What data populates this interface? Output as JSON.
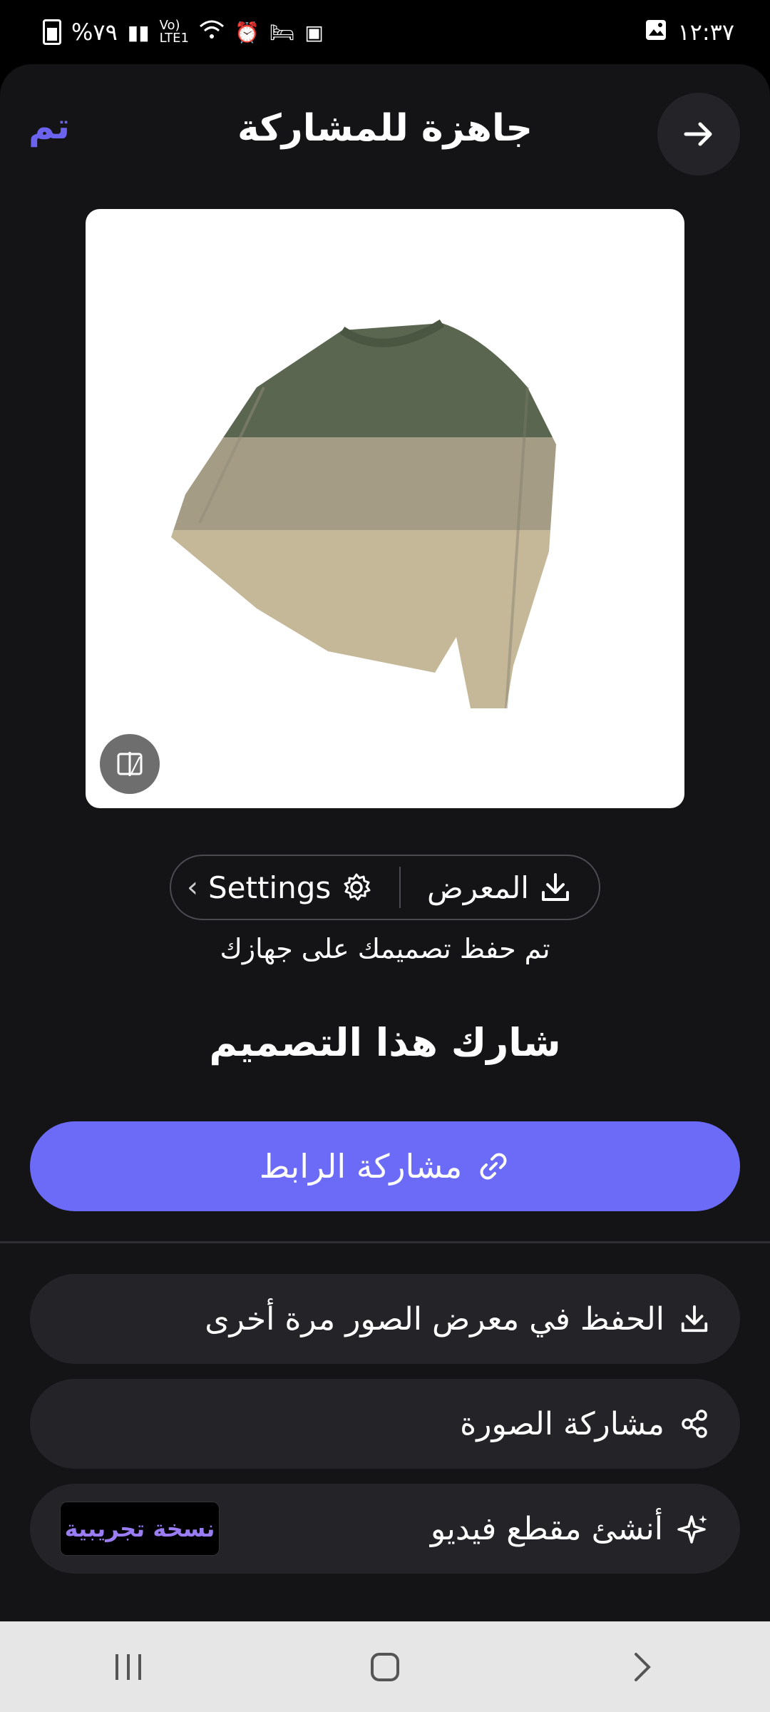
{
  "status_bar": {
    "time": "١٢:٣٧",
    "battery": "%٧٩",
    "icons": [
      "battery-icon",
      "signal-icon",
      "volte-icon",
      "wifi-icon",
      "alarm-icon",
      "sleep-icon",
      "notification-icon",
      "gallery-icon"
    ]
  },
  "header": {
    "title": "جاهزة للمشاركة",
    "done_label": "تم",
    "forward_icon": "arrow-right-icon"
  },
  "preview": {
    "image": "sweater-image",
    "compare_icon": "compare-icon"
  },
  "action_pill": {
    "gallery_label": "المعرض",
    "settings_label": "Settings"
  },
  "saved_text": "تم حفظ تصميمك على جهازك",
  "share_heading": "شارك هذا التصميم",
  "share_link_label": "مشاركة الرابط",
  "rows": {
    "save_again": "الحفظ في معرض الصور مرة أخرى",
    "share_image": "مشاركة الصورة",
    "create_video": "أنشئ مقطع فيديو",
    "beta_badge": "نسخة تجريبية"
  },
  "colors": {
    "accent": "#6b6bf7",
    "background": "#141417",
    "surface": "#232328"
  }
}
